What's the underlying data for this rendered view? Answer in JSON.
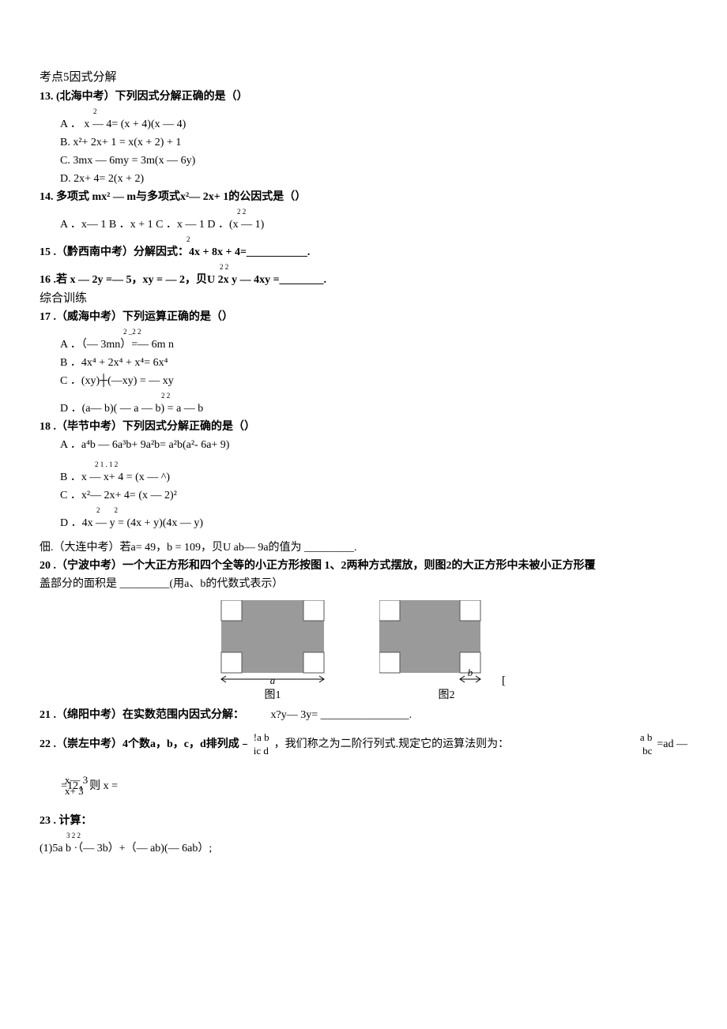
{
  "section5": {
    "title": "考点5因式分解",
    "q13": {
      "stem": "13.  (北海中考）下列因式分解正确的是（）",
      "a_sup": "2",
      "a": "A ． x — 4= (x + 4)(x — 4)",
      "b": "B.   x²+ 2x+ 1 = x(x + 2) + 1",
      "c": "C.   3mx — 6my = 3m(x — 6y)",
      "d": "D.   2x+ 4= 2(x + 2)"
    },
    "q14": {
      "stem": "14.   多项式 mx² — m与多项式x²— 2x+ 1的公因式是（）",
      "c_sup": "2 2",
      "line": "A ．x— 1 B ．x + 1              C ．x — 1              D  ．(x — 1)"
    },
    "q15": {
      "sup": "2",
      "line": "15  .（黔西南中考）分解因式：4x + 8x + 4=___________."
    },
    "q16": {
      "sup": "2 2",
      "line": "16  .若 x — 2y =— 5，xy = — 2，贝U 2x y — 4xy =________."
    }
  },
  "综合": {
    "title": "综合训练",
    "q17": {
      "stem": "17  .（威海中考）下列运算正确的是（）",
      "a_sup": "2 _2 2",
      "a": "A ．（— 3mn）=— 6m n",
      "b": "B ．4x⁴ + 2x⁴ + x⁴= 6x⁴",
      "c": "C ．(xy)┼(—xy) = — xy",
      "d_sup": "2 2",
      "d": "D ．(a— b)( — a — b) = a — b"
    },
    "q18": {
      "stem": "18  .（毕节中考）下列因式分解正确的是（）",
      "a": "A ．a⁴b — 6a³b+ 9a²b= a²b(a²- 6a+ 9)",
      "b_sup": "2 1 . 1 2",
      "b": "B ．x — x+ 4 = (x — ^)",
      "c": "C ．x²— 2x+ 4= (x — 2)²",
      "d_sup": "2        2",
      "d": "D ．4x — y = (4x + y)(4x — y)"
    },
    "q19": {
      "line": "佃.（大连中考）若a= 49，b = 109，贝U ab— 9a的值为 _________."
    },
    "q20": {
      "line1": "20  .（宁波中考）一个大正方形和四个全等的小正方形按图      1、2两种方式摆放，则图2的大正方形中未被小正方形覆",
      "line2": "盖部分的面积是 _________(用a、b的代数式表示）",
      "fig1": {
        "label_a": "a",
        "caption": "图1"
      },
      "fig2": {
        "label_b": "b",
        "caption": "图2",
        "bracket": "["
      }
    },
    "q21": {
      "pre": "21  .（绵阳中考）在实数范围内因式分解：",
      "expr": "x?y— 3y= ________________."
    },
    "q22": {
      "pre": "22  .（崇左中考）4个数a，b，c，d排列成",
      "m1top": "!a b",
      "m1bot": "ic d",
      "mid": "，我们称之为二阶行列式.规定它的运算法则为：",
      "m2top": "a b",
      "m2bot": "bc",
      "after": "=ad —",
      "eq_top": "x— 3",
      "eq_mid": "=12，则 x =",
      "eq_bot": "x+ 3"
    },
    "q23": {
      "stem": "23 . 计算：",
      "sup": "3 2 2",
      "line": "(1)5a b  ·（— 3b）+（— ab)(— 6ab）;"
    }
  }
}
